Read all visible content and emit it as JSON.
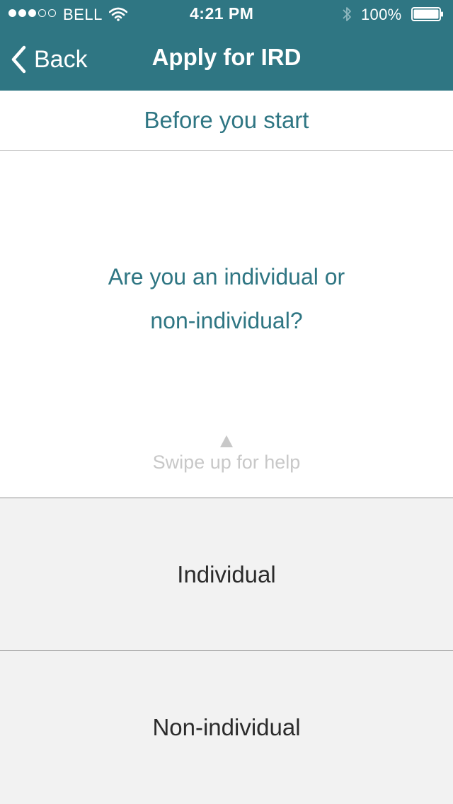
{
  "status_bar": {
    "carrier": "BELL",
    "signal_bars_filled": 3,
    "signal_bars_total": 5,
    "time": "4:21 PM",
    "battery_percent": "100%",
    "battery_level": 1.0,
    "icons": [
      "wifi-icon",
      "bluetooth-icon",
      "battery-icon"
    ]
  },
  "nav": {
    "back_label": "Back",
    "title": "Apply for IRD"
  },
  "section_header": "Before you start",
  "question": {
    "line1": "Are you an individual or",
    "line2": "non-individual?"
  },
  "swipe_hint": "Swipe up for help",
  "options": [
    {
      "label": "Individual"
    },
    {
      "label": "Non-individual"
    }
  ],
  "colors": {
    "primary": "#2f7683",
    "option_bg": "#f2f2f2",
    "hint": "#c8c8c8"
  }
}
